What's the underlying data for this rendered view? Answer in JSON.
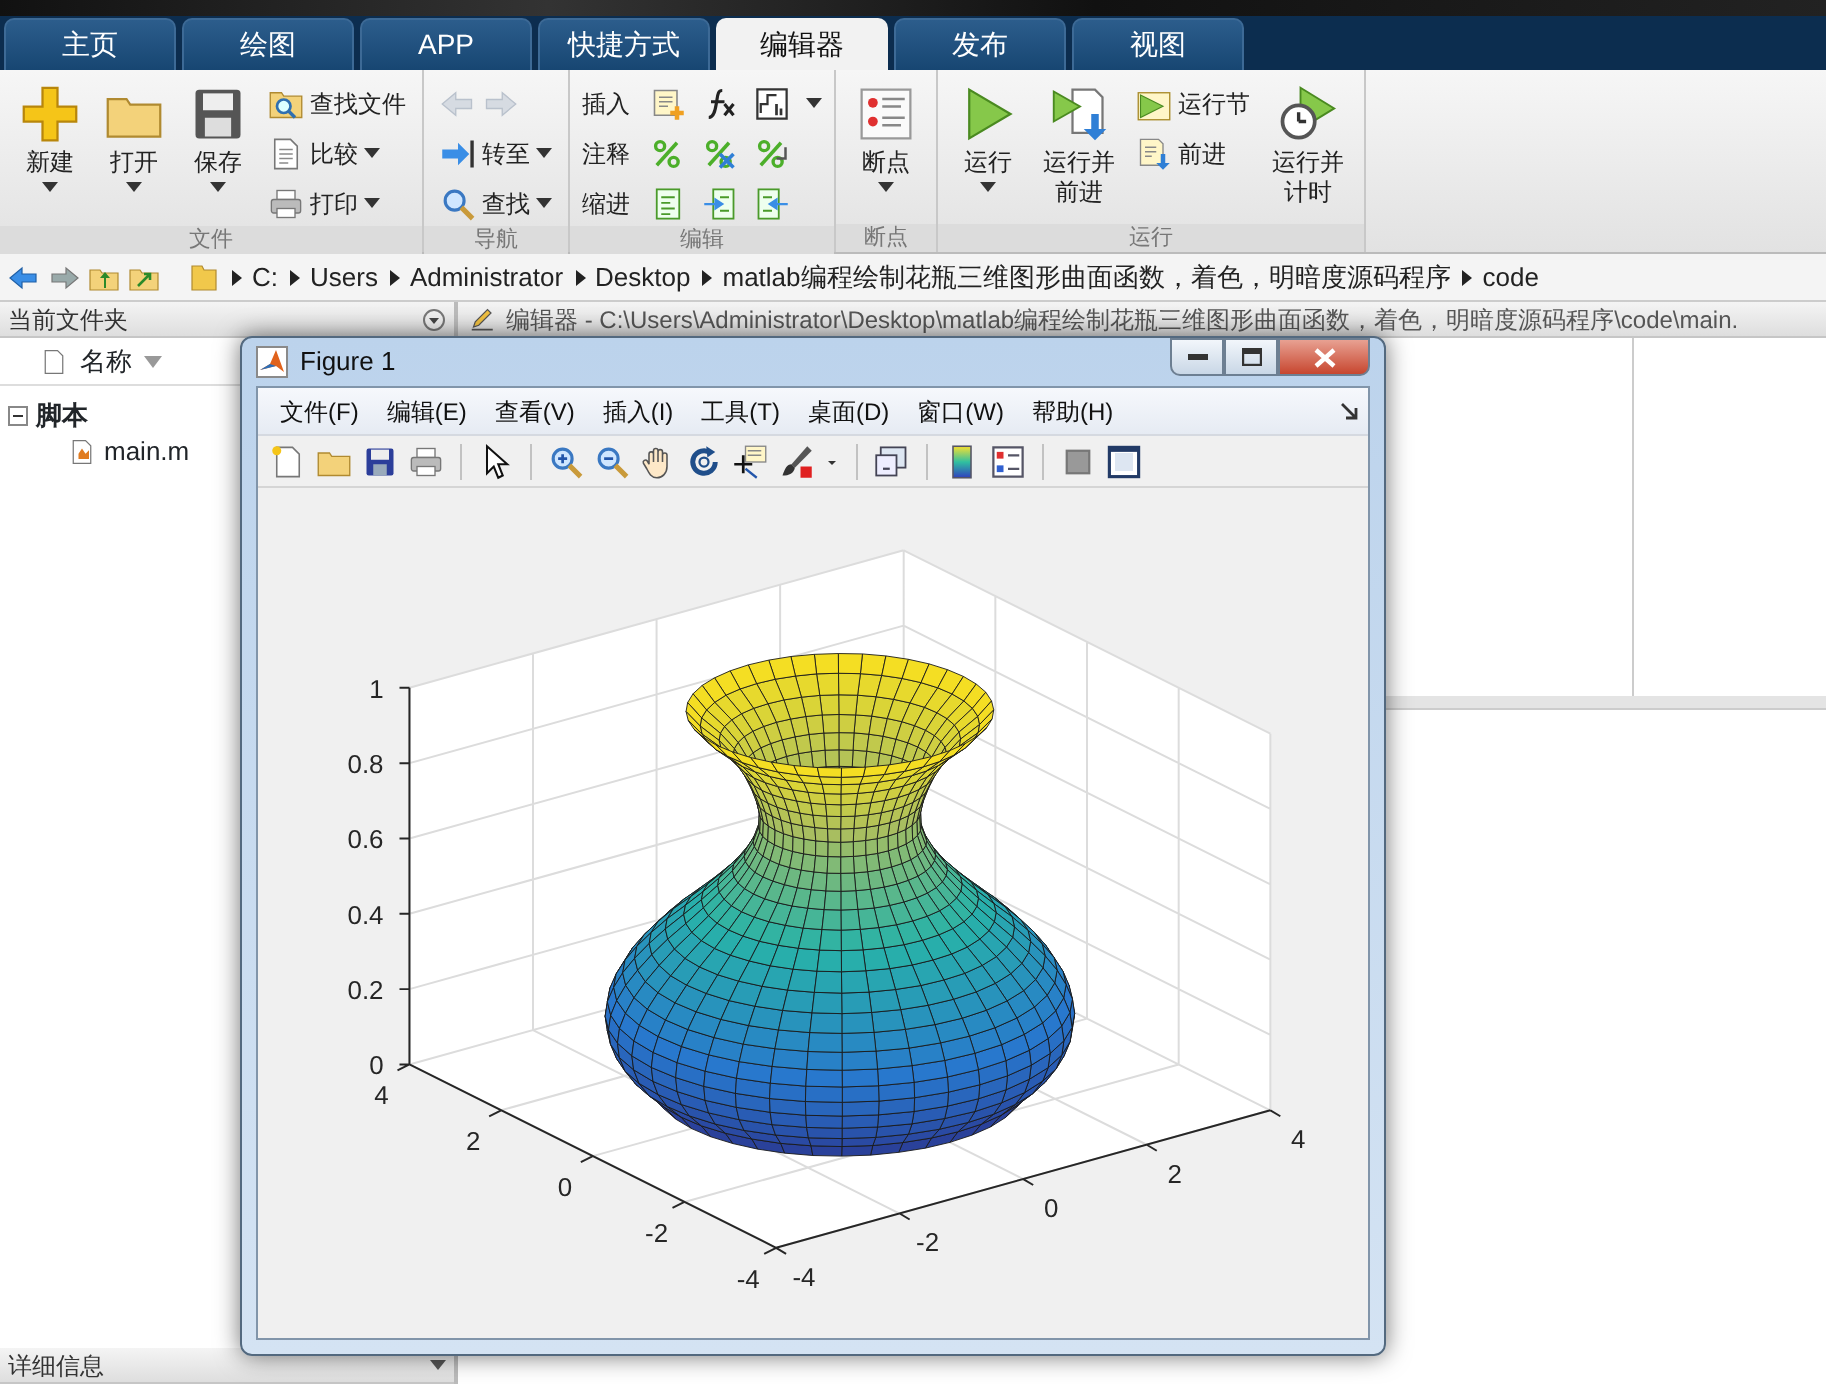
{
  "ribbon": {
    "tabs": [
      {
        "label": "主页",
        "selected": false
      },
      {
        "label": "绘图",
        "selected": false
      },
      {
        "label": "APP",
        "selected": false
      },
      {
        "label": "快捷方式",
        "selected": false
      },
      {
        "label": "编辑器",
        "selected": true
      },
      {
        "label": "发布",
        "selected": false
      },
      {
        "label": "视图",
        "selected": false
      }
    ],
    "groups": [
      {
        "title": "文件",
        "items": [
          {
            "kind": "large",
            "label": "新建",
            "dropdown": true
          },
          {
            "kind": "large",
            "label": "打开",
            "dropdown": true
          },
          {
            "kind": "large",
            "label": "保存",
            "dropdown": true
          },
          {
            "kind": "stack",
            "buttons": [
              {
                "kind": "small",
                "label": "查找文件",
                "dropdown": false
              },
              {
                "kind": "small",
                "label": "比较",
                "dropdown": true
              },
              {
                "kind": "small",
                "label": "打印",
                "dropdown": true
              }
            ]
          }
        ]
      },
      {
        "title": "导航",
        "items": [
          {
            "kind": "stack",
            "buttons": [
              {
                "kind": "arrows",
                "disabled": true
              },
              {
                "kind": "small",
                "label": "转至",
                "dropdown": true
              },
              {
                "kind": "small",
                "label": "查找",
                "dropdown": true
              }
            ]
          }
        ]
      },
      {
        "title": "编辑",
        "items": [
          {
            "kind": "rows",
            "rows": [
              {
                "label": "插入",
                "dropdown": true
              },
              {
                "label": "注释",
                "dropdown": false
              },
              {
                "label": "缩进",
                "dropdown": false
              }
            ]
          }
        ]
      },
      {
        "title": "断点",
        "items": [
          {
            "kind": "large",
            "label": "断点",
            "dropdown": true
          }
        ]
      },
      {
        "title": "运行",
        "items": [
          {
            "kind": "large",
            "label": "运行",
            "dropdown": true
          },
          {
            "kind": "large",
            "label": "运行并前进",
            "dropdown": false
          },
          {
            "kind": "stack",
            "buttons": [
              {
                "kind": "small",
                "label": "运行节",
                "dropdown": false
              },
              {
                "kind": "small",
                "label": "前进",
                "dropdown": false
              }
            ]
          },
          {
            "kind": "large",
            "label": "运行并计时",
            "dropdown": false
          }
        ]
      }
    ]
  },
  "address_bar": {
    "path": [
      "C:",
      "Users",
      "Administrator",
      "Desktop",
      "matlab编程绘制花瓶三维图形曲面函数，着色，明暗度源码程序",
      "code"
    ]
  },
  "current_folder": {
    "title": "当前文件夹",
    "column": "名称",
    "tree": [
      {
        "label": "脚本",
        "expanded": true,
        "children": [
          {
            "label": "main.m"
          }
        ]
      }
    ]
  },
  "details_panel": {
    "title": "详细信息"
  },
  "editor": {
    "title": "编辑器 - C:\\Users\\Administrator\\Desktop\\matlab编程绘制花瓶三维图形曲面函数，着色，明暗度源码程序\\code\\main."
  },
  "figure": {
    "title": "Figure 1",
    "menus": [
      "文件(F)",
      "编辑(E)",
      "查看(V)",
      "插入(I)",
      "工具(T)",
      "桌面(D)",
      "窗口(W)",
      "帮助(H)"
    ],
    "plot": {
      "z_ticks": [
        "1",
        "0.8",
        "0.6",
        "0.4",
        "0.2",
        "0"
      ],
      "y_ticks": [
        "4",
        "2",
        "0",
        "-2",
        "-4"
      ],
      "x_ticks": [
        "-4",
        "-2",
        "0",
        "2",
        "4"
      ]
    }
  }
}
